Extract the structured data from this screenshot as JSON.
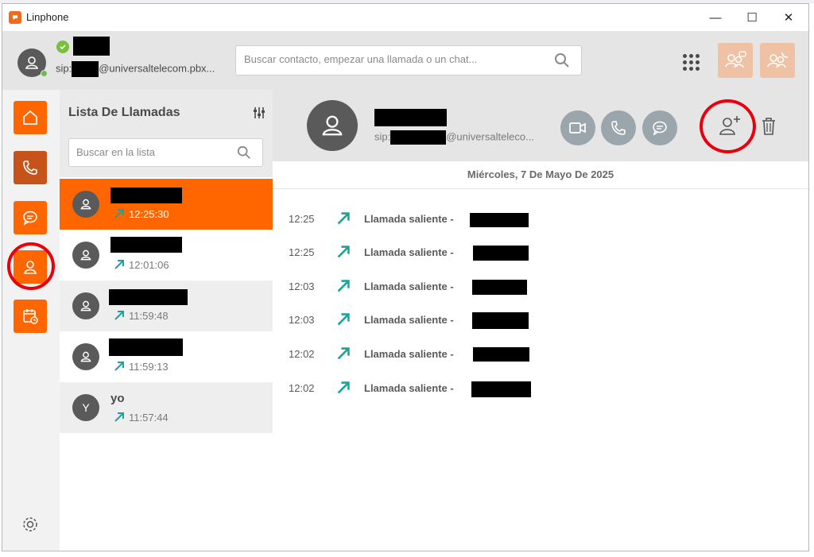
{
  "window": {
    "title": "Linphone",
    "controls": {
      "minimize": "—",
      "maximize": "☐",
      "close": "✕"
    }
  },
  "account": {
    "sip_prefix": "sip:",
    "sip_domain": "@universaltelecom.pbx...",
    "status": "online"
  },
  "search": {
    "placeholder": "Buscar contacto, empezar una llamada o un chat..."
  },
  "nav": {
    "items": [
      "home",
      "calls",
      "chat",
      "contacts",
      "meetings"
    ],
    "active": "contacts"
  },
  "call_list": {
    "title": "Lista De Llamadas",
    "search_placeholder": "Buscar en la lista",
    "items": [
      {
        "name": "",
        "initial": "",
        "time": "12:25:30",
        "selected": true
      },
      {
        "name": "",
        "initial": "",
        "time": "12:01:06",
        "selected": false
      },
      {
        "name": "",
        "initial": "",
        "time": "11:59:48",
        "selected": false
      },
      {
        "name": "",
        "initial": "",
        "time": "11:59:13",
        "selected": false
      },
      {
        "name": "yo",
        "initial": "Y",
        "time": "11:57:44",
        "selected": false
      }
    ]
  },
  "detail": {
    "sip_prefix": "sip:",
    "sip_domain": "@universaltelecо...",
    "date": "Miércoles, 7 De Mayo De 2025",
    "history": [
      {
        "time": "12:25",
        "label": "Llamada saliente -"
      },
      {
        "time": "12:25",
        "label": "Llamada saliente -"
      },
      {
        "time": "12:03",
        "label": "Llamada saliente -"
      },
      {
        "time": "12:03",
        "label": "Llamada saliente -"
      },
      {
        "time": "12:02",
        "label": "Llamada saliente -"
      },
      {
        "time": "12:02",
        "label": "Llamada saliente -"
      }
    ]
  },
  "colors": {
    "brand_orange": "#ff6600",
    "calls_dark_orange": "#c6541a",
    "teal_arrow": "#1aa39a",
    "highlight_red": "#e8000c",
    "action_gray": "#9aa5ac"
  }
}
